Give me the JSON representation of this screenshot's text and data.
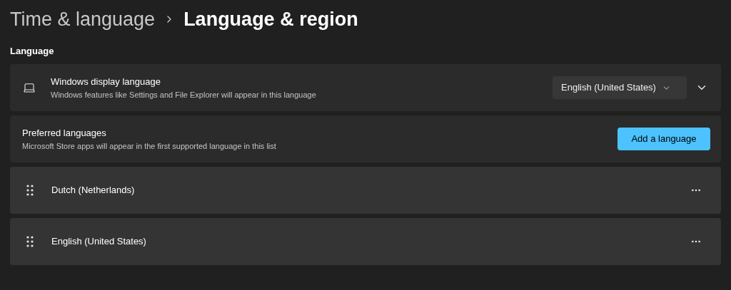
{
  "breadcrumb": {
    "parent": "Time & language",
    "current": "Language & region"
  },
  "section_title": "Language",
  "display_language": {
    "title": "Windows display language",
    "description": "Windows features like Settings and File Explorer will appear in this language",
    "value": "English (United States)",
    "expanded": false
  },
  "preferred": {
    "title": "Preferred languages",
    "description": "Microsoft Store apps will appear in the first supported language in this list",
    "button": "Add a language"
  },
  "languages": [
    {
      "name": "Dutch (Netherlands)"
    },
    {
      "name": "English (United States)"
    }
  ]
}
